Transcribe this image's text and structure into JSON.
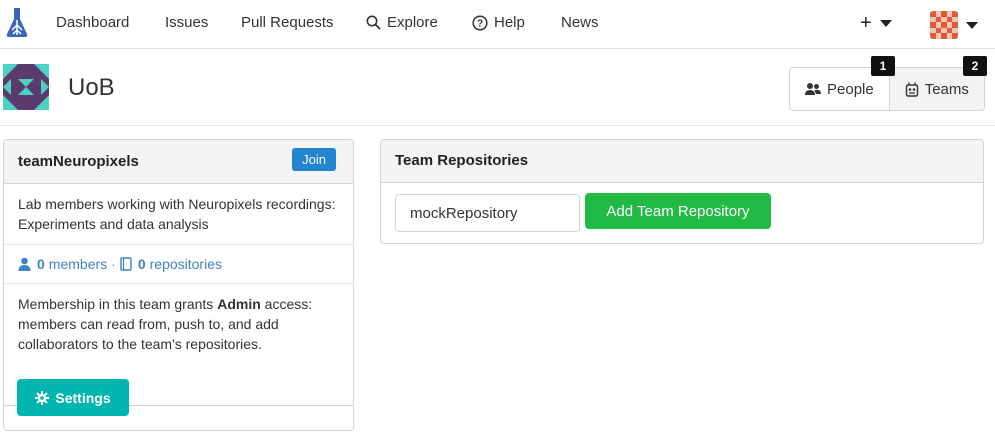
{
  "nav": {
    "items": [
      {
        "label": "Dashboard"
      },
      {
        "label": "Issues"
      },
      {
        "label": "Pull Requests"
      },
      {
        "label": "Explore",
        "icon": "search-icon"
      },
      {
        "label": "Help",
        "icon": "help-circle-icon"
      },
      {
        "label": "News"
      }
    ],
    "plus_label": "+"
  },
  "org": {
    "name": "UoB",
    "tabs": [
      {
        "label": "People",
        "icon": "people-icon",
        "shortcut": "1"
      },
      {
        "label": "Teams",
        "icon": "teams-icon",
        "shortcut": "2",
        "active": true
      }
    ]
  },
  "team": {
    "name": "teamNeuropixels",
    "join_label": "Join",
    "description": "Lab members working with Neuropixels recordings: Experiments and data analysis",
    "members_count": "0",
    "members_label": "members",
    "separator": "·",
    "repos_count": "0",
    "repos_label": "repositories",
    "perm_prefix": "Membership in this team grants ",
    "perm_level": "Admin",
    "perm_suffix": " access: members can read from, push to, and add collaborators to the team's repositories.",
    "settings_label": "Settings"
  },
  "repos": {
    "title": "Team Repositories",
    "input_value": "mockRepository",
    "add_label": "Add Team Repository"
  },
  "colors": {
    "join": "#2185d0",
    "settings": "#00b5ad",
    "add": "#21ba45",
    "link": "#4183c4"
  }
}
